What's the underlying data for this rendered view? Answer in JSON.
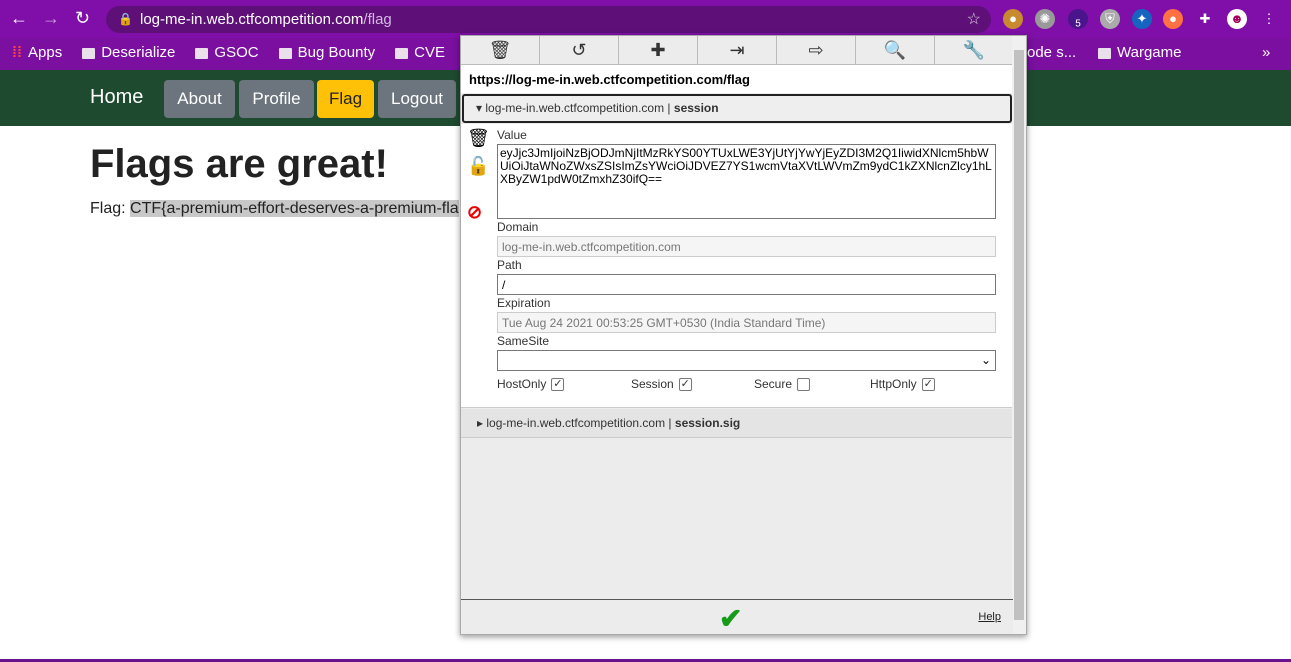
{
  "browser": {
    "url_host": "log-me-in.web.ctfcompetition.com",
    "url_path": "/flag",
    "extension_badge": "5",
    "bookmarks": [
      "Apps",
      "Deserialize",
      "GSOC",
      "Bug Bounty",
      "CVE",
      "ode s...",
      "Wargame"
    ],
    "more": "»"
  },
  "site": {
    "home": "Home",
    "nav": [
      "About",
      "Profile",
      "Flag",
      "Logout"
    ],
    "active_color": "#ffc107",
    "title": "Flags are great!",
    "flag_label": "Flag:",
    "flag_value": "CTF{a-premium-effort-deserves-a-premium-fla"
  },
  "editor": {
    "url": "https://log-me-in.web.ctfcompetition.com/flag",
    "cookie1": {
      "domain": "log-me-in.web.ctfcompetition.com",
      "sep": " | ",
      "name": "session"
    },
    "labels": {
      "value": "Value",
      "domain": "Domain",
      "path": "Path",
      "expiration": "Expiration",
      "samesite": "SameSite"
    },
    "value": "eyJjc3JmIjoiNzBjODJmNjItMzRkYS00YTUxLWE3YjUtYjYwYjEyZDI3M2Q1IiwidXNlcm5hbWUiOiJtaWNoZWxsZSIsImZsYWciOiJDVEZ7YS1wcmVtaXVtLWVmZm9ydC1kZXNlcnZlcy1hLXByZW1pdW0tZmxhZ30ifQ==",
    "domain": "log-me-in.web.ctfcompetition.com",
    "path": "/",
    "expiration": "Tue Aug 24 2021 00:53:25 GMT+0530 (India Standard Time)",
    "samesite": "",
    "flags": [
      {
        "label": "HostOnly",
        "checked": true
      },
      {
        "label": "Session",
        "checked": true
      },
      {
        "label": "Secure",
        "checked": false
      },
      {
        "label": "HttpOnly",
        "checked": true
      }
    ],
    "cookie2": {
      "domain": "log-me-in.web.ctfcompetition.com",
      "sep": " | ",
      "name": "session.sig"
    },
    "help": "Help"
  }
}
